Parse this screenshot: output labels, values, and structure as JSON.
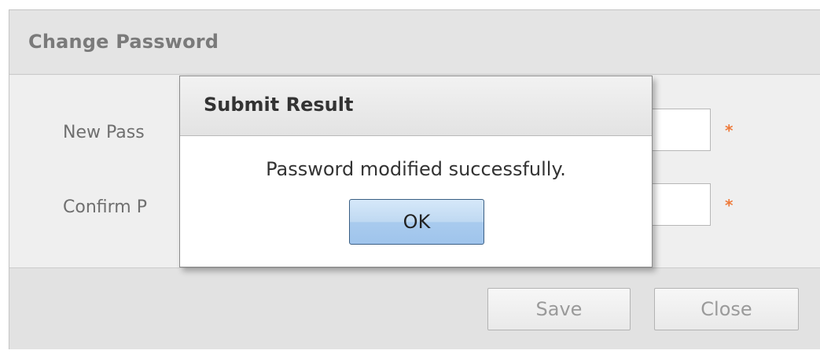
{
  "window": {
    "title": "Change Password",
    "form": {
      "new_password_label": "New Pass",
      "confirm_password_label": "Confirm P",
      "new_password_value": "",
      "confirm_password_value": "",
      "required_marker": "*"
    },
    "footer": {
      "save_label": "Save",
      "close_label": "Close"
    }
  },
  "dialog": {
    "title": "Submit Result",
    "message": "Password modified successfully.",
    "ok_label": "OK"
  },
  "colors": {
    "required": "#ee7a3a",
    "ok_button": "#a9cbee",
    "disabled_text": "#9a9a9a"
  }
}
